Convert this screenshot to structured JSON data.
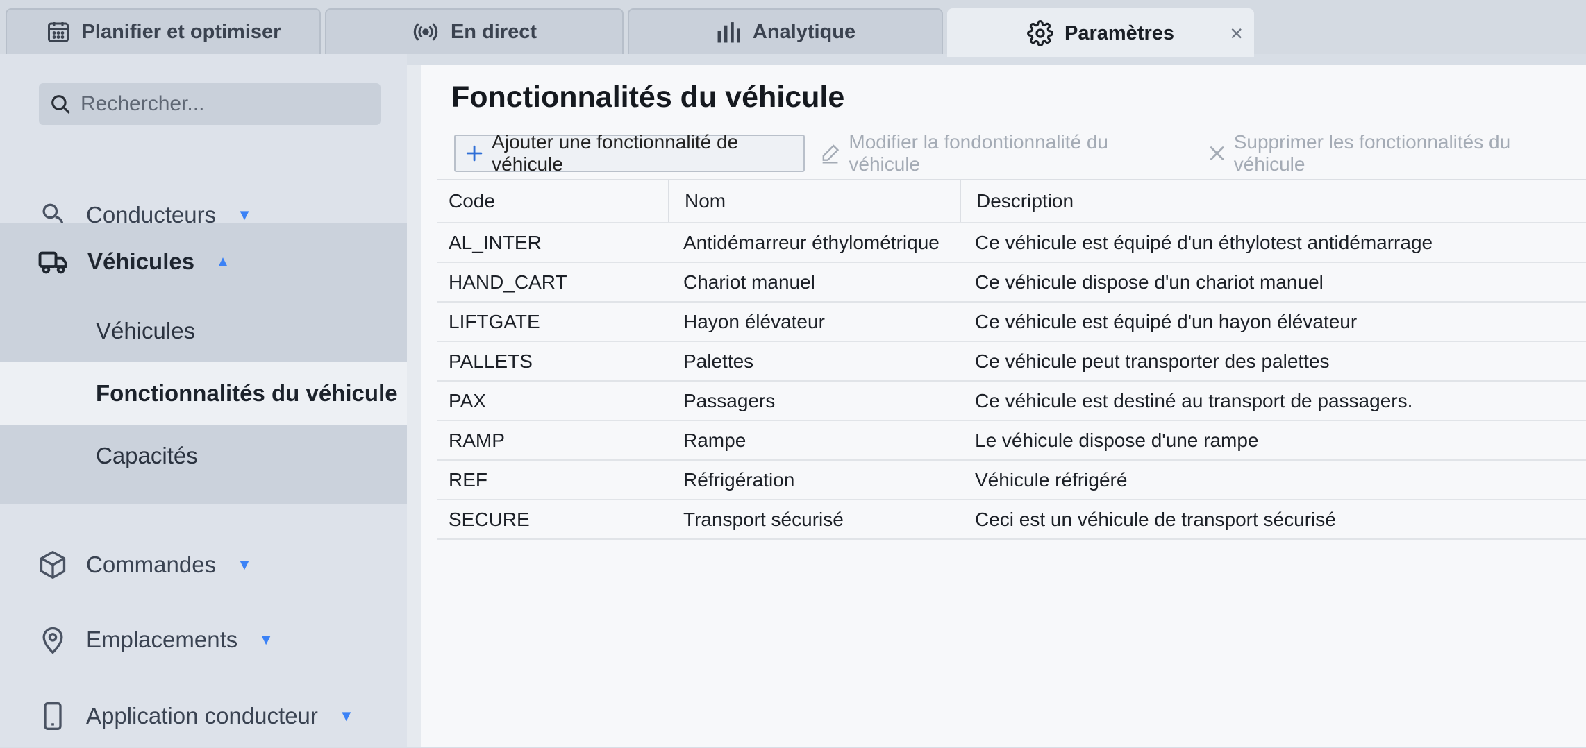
{
  "tabs": [
    {
      "label": "Planifier et optimiser",
      "icon": "calendar-icon"
    },
    {
      "label": "En direct",
      "icon": "broadcast-icon"
    },
    {
      "label": "Analytique",
      "icon": "bar-chart-icon"
    },
    {
      "label": "Paramètres",
      "icon": "gear-icon",
      "active": true
    }
  ],
  "tab_close": "×",
  "search": {
    "placeholder": "Rechercher..."
  },
  "sidebar": {
    "items": [
      {
        "label": "Conducteurs",
        "icon": "person-icon",
        "caret": "▼"
      },
      {
        "label": "Véhicules",
        "icon": "truck-icon",
        "caret": "▲",
        "expanded": true
      },
      {
        "label": "Commandes",
        "icon": "box-icon",
        "caret": "▼"
      },
      {
        "label": "Emplacements",
        "icon": "map-pin-icon",
        "caret": "▼"
      },
      {
        "label": "Application conducteur",
        "icon": "phone-icon",
        "caret": "▼"
      }
    ],
    "subitems": [
      {
        "label": "Véhicules"
      },
      {
        "label": "Fonctionnalités du véhicule",
        "selected": true
      },
      {
        "label": "Capacités"
      }
    ]
  },
  "main": {
    "title": "Fonctionnalités du véhicule",
    "toolbar": {
      "add": "Ajouter une fonctionnalité de véhicule",
      "edit": "Modifier la fondontionnalité du véhicule",
      "delete": "Supprimer les fonctionnalités du véhicule"
    },
    "table": {
      "headers": [
        "Code",
        "Nom",
        "Description"
      ],
      "rows": [
        [
          "AL_INTER",
          "Antidémarreur éthylométrique",
          "Ce véhicule est équipé d'un éthylotest antidémarrage"
        ],
        [
          "HAND_CART",
          "Chariot manuel",
          "Ce véhicule dispose d'un chariot manuel"
        ],
        [
          "LIFTGATE",
          "Hayon élévateur",
          "Ce véhicule est équipé d'un hayon élévateur"
        ],
        [
          "PALLETS",
          "Palettes",
          "Ce véhicule peut transporter des palettes"
        ],
        [
          "PAX",
          "Passagers",
          "Ce véhicule est destiné au transport de passagers."
        ],
        [
          "RAMP",
          "Rampe",
          "Le véhicule dispose d'une rampe"
        ],
        [
          "REF",
          "Réfrigération",
          "Véhicule réfrigéré"
        ],
        [
          "SECURE",
          "Transport sécurisé",
          "Ceci est un véhicule de transport sécurisé"
        ]
      ]
    }
  },
  "colors": {
    "accent": "#3b82f6",
    "selected_bg": "#edf0f4",
    "group_bg": "#cbd2dc"
  }
}
